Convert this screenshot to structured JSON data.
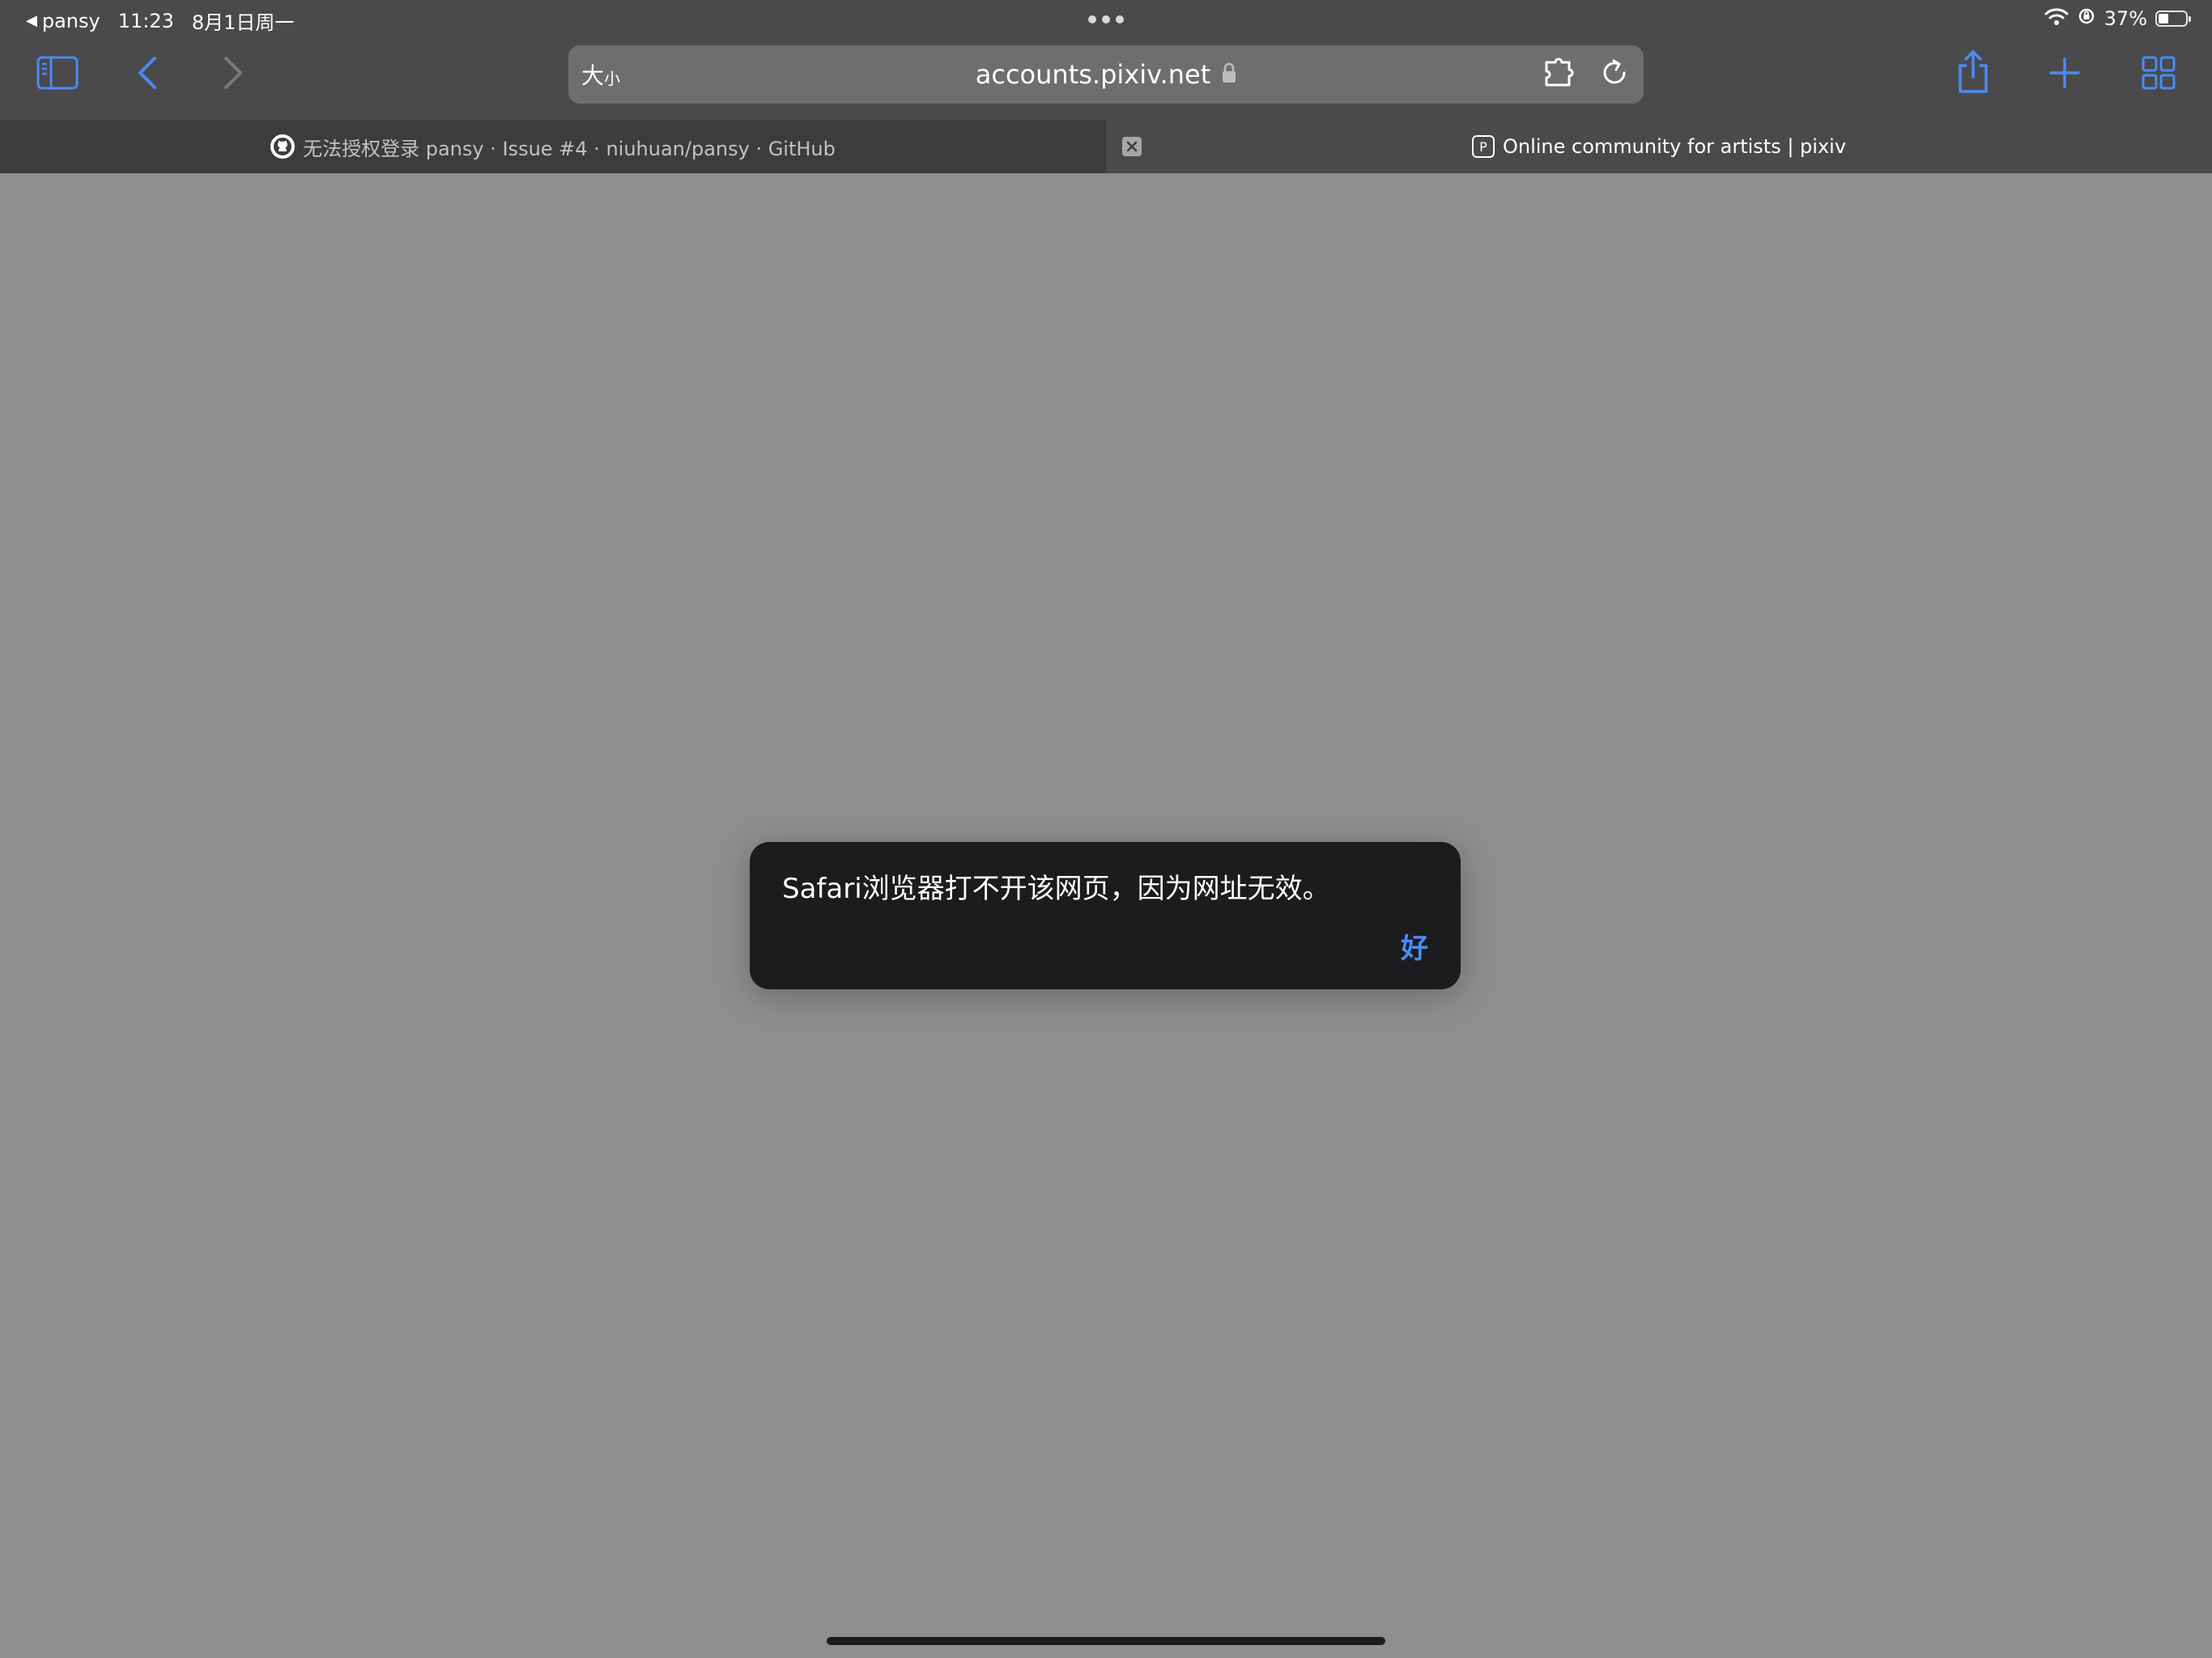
{
  "status_bar": {
    "back_app": "pansy",
    "time": "11:23",
    "date": "8月1日周一",
    "battery_percent": "37%",
    "battery_level": 0.37
  },
  "toolbar": {
    "text_size_big": "大",
    "text_size_small": "小",
    "url": "accounts.pixiv.net",
    "icons": [
      "sidebar-icon",
      "back-icon",
      "forward-icon",
      "extension-icon",
      "reload-icon",
      "share-icon",
      "plus-icon",
      "tabs-overview-icon"
    ],
    "accent_color": "#4a8bf5"
  },
  "tabs": [
    {
      "title": "无法授权登录 pansy · Issue #4 · niuhuan/pansy · GitHub",
      "favicon": "github-icon"
    },
    {
      "title": "Online community for artists | pixiv",
      "favicon": "P",
      "active": true
    }
  ],
  "alert": {
    "message": "Safari浏览器打不开该网页，因为网址无效。",
    "ok_label": "好"
  }
}
